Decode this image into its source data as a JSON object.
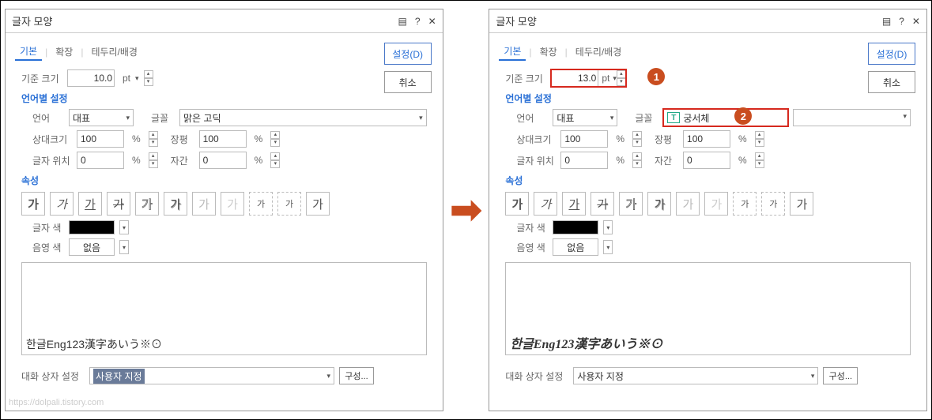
{
  "title": "글자 모양",
  "tabs": {
    "basic": "기본",
    "ext": "확장",
    "border": "테두리/배경"
  },
  "btn_apply": "설정(D)",
  "btn_cancel": "취소",
  "labels": {
    "base_size": "기준 크기",
    "lang_section": "언어별 설정",
    "language": "언어",
    "font": "글꼴",
    "rel_size": "상대크기",
    "width": "장평",
    "pos": "글자 위치",
    "spacing": "자간",
    "attr_section": "속성",
    "char_color": "글자 색",
    "shade_color": "음영 색",
    "none": "없음",
    "dlg_config": "대화 상자 설정",
    "user": "사용자 지정",
    "config": "구성..."
  },
  "unit_pt": "pt",
  "unit_pct": "%",
  "left": {
    "size": "10.0",
    "lang": "대표",
    "font": "맑은 고딕",
    "rel": "100",
    "width": "100",
    "pos": "0",
    "spacing": "0",
    "preview": "한글Eng123漢字あいう※⊙"
  },
  "right": {
    "size": "13.0",
    "lang": "대표",
    "font": "궁서체",
    "rel": "100",
    "width": "100",
    "pos": "0",
    "spacing": "0",
    "preview": "한글Eng123漢字あいう※⊙"
  },
  "style_glyph": "가",
  "style_small": "가",
  "badge1": "1",
  "badge2": "2",
  "watermark": "https://dolpali.tistory.com"
}
